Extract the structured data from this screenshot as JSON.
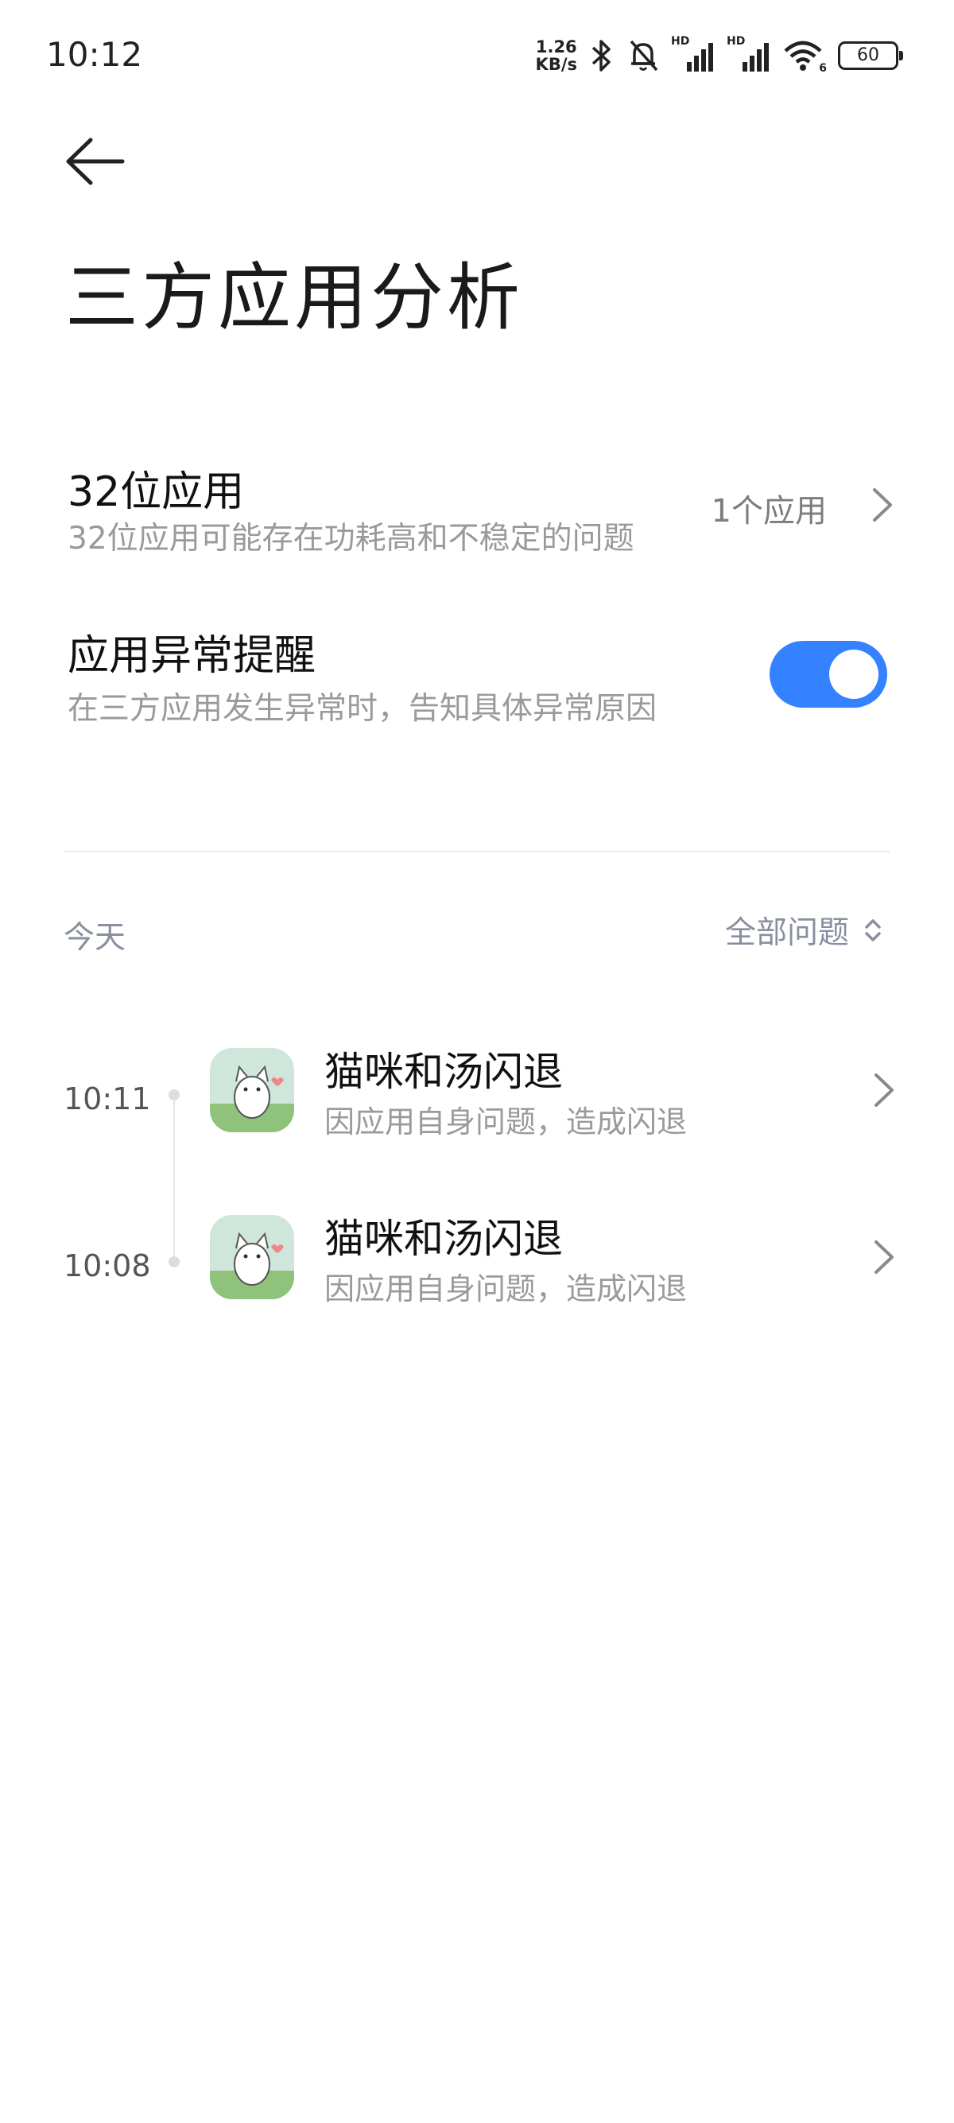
{
  "status_bar": {
    "time": "10:12",
    "net_speed_value": "1.26",
    "net_speed_unit": "KB/s",
    "signal1_label": "HD",
    "signal2_label": "HD",
    "wifi_label": "6",
    "battery": "60",
    "icons": [
      "bluetooth-icon",
      "mute-bell-icon",
      "signal-icon",
      "signal-icon",
      "wifi-icon",
      "battery-icon"
    ]
  },
  "header": {
    "title": "三方应用分析"
  },
  "settings": {
    "apps32": {
      "title": "32位应用",
      "subtitle": "32位应用可能存在功耗高和不稳定的问题",
      "value": "1个应用"
    },
    "crash_alert": {
      "title": "应用异常提醒",
      "subtitle": "在三方应用发生异常时，告知具体异常原因",
      "enabled": true
    }
  },
  "log": {
    "section_label": "今天",
    "filter_label": "全部问题",
    "events": [
      {
        "time": "10:11",
        "title": "猫咪和汤闪退",
        "subtitle": "因应用自身问题，造成闪退"
      },
      {
        "time": "10:08",
        "title": "猫咪和汤闪退",
        "subtitle": "因应用自身问题，造成闪退"
      }
    ]
  },
  "colors": {
    "accent": "#3482ff",
    "secondary_text": "#9a9a9a",
    "section_text": "#8a8fa0"
  }
}
